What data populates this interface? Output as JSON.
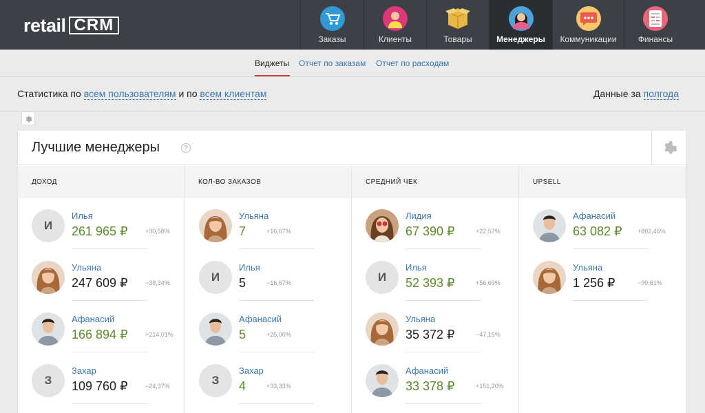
{
  "app": {
    "logo_main": "retail",
    "logo_crm": "CRM"
  },
  "nav": [
    {
      "label": "Заказы",
      "icon": "shopping-cart-icon",
      "color": "#2f9ad6"
    },
    {
      "label": "Клиенты",
      "icon": "client-person-icon",
      "color": "#e0367a"
    },
    {
      "label": "Товары",
      "icon": "product-box-icon",
      "color": "#e8b844"
    },
    {
      "label": "Менеджеры",
      "icon": "manager-person-icon",
      "color": "#4ba3d9"
    },
    {
      "label": "Коммуникации",
      "icon": "chat-bubble-icon",
      "color": "#ef5b4b"
    },
    {
      "label": "Финансы",
      "icon": "finance-document-icon",
      "color": "#e8657a"
    }
  ],
  "subtabs": {
    "widgets": "Виджеты",
    "orders_report": "Отчет по заказам",
    "expenses_report": "Отчет по расходам"
  },
  "filters": {
    "prefix": "Статистика по",
    "users_link": "всем пользователям",
    "middle": "и по",
    "clients_link": "всем клиентам",
    "period_prefix": "Данные за",
    "period_link": "полгода"
  },
  "widget": {
    "title": "Лучшие менеджеры",
    "help": "?",
    "columns": [
      "ДОХОД",
      "КОЛ-ВО ЗАКАЗОВ",
      "СРЕДНИЙ ЧЕК",
      "UPSELL"
    ]
  },
  "entries": {
    "income": [
      {
        "name": "Илья",
        "value": "261 965 ₽",
        "pct": "+30,58%",
        "avatar": "letter",
        "letter": "И",
        "positive": true
      },
      {
        "name": "Ульяна",
        "value": "247 609 ₽",
        "pct": "−38,34%",
        "avatar": "photo-woman",
        "positive": false
      },
      {
        "name": "Афанасий",
        "value": "166 894 ₽",
        "pct": "+214,01%",
        "avatar": "photo-man",
        "positive": true
      },
      {
        "name": "Захар",
        "value": "109 760 ₽",
        "pct": "−24,37%",
        "avatar": "letter",
        "letter": "З",
        "positive": false
      }
    ],
    "orders": [
      {
        "name": "Ульяна",
        "value": "7",
        "pct": "+16,67%",
        "avatar": "photo-woman",
        "positive": true
      },
      {
        "name": "Илья",
        "value": "5",
        "pct": "−16,67%",
        "avatar": "letter",
        "letter": "И",
        "positive": false
      },
      {
        "name": "Афанасий",
        "value": "5",
        "pct": "+25,00%",
        "avatar": "photo-man",
        "positive": true
      },
      {
        "name": "Захар",
        "value": "4",
        "pct": "+33,33%",
        "avatar": "letter",
        "letter": "З",
        "positive": true
      }
    ],
    "avg_check": [
      {
        "name": "Лидия",
        "value": "67 390 ₽",
        "pct": "+22,57%",
        "avatar": "photo-woman-glasses",
        "positive": true
      },
      {
        "name": "Илья",
        "value": "52 393 ₽",
        "pct": "+56,69%",
        "avatar": "letter",
        "letter": "И",
        "positive": true
      },
      {
        "name": "Ульяна",
        "value": "35 372 ₽",
        "pct": "−47,15%",
        "avatar": "photo-woman",
        "positive": false
      },
      {
        "name": "Афанасий",
        "value": "33 378 ₽",
        "pct": "+151,20%",
        "avatar": "photo-man",
        "positive": true
      }
    ],
    "upsell": [
      {
        "name": "Афанасий",
        "value": "63 082 ₽",
        "pct": "+802,46%",
        "avatar": "photo-man",
        "positive": true
      },
      {
        "name": "Ульяна",
        "value": "1 256 ₽",
        "pct": "−99,61%",
        "avatar": "photo-woman",
        "positive": false
      }
    ]
  }
}
